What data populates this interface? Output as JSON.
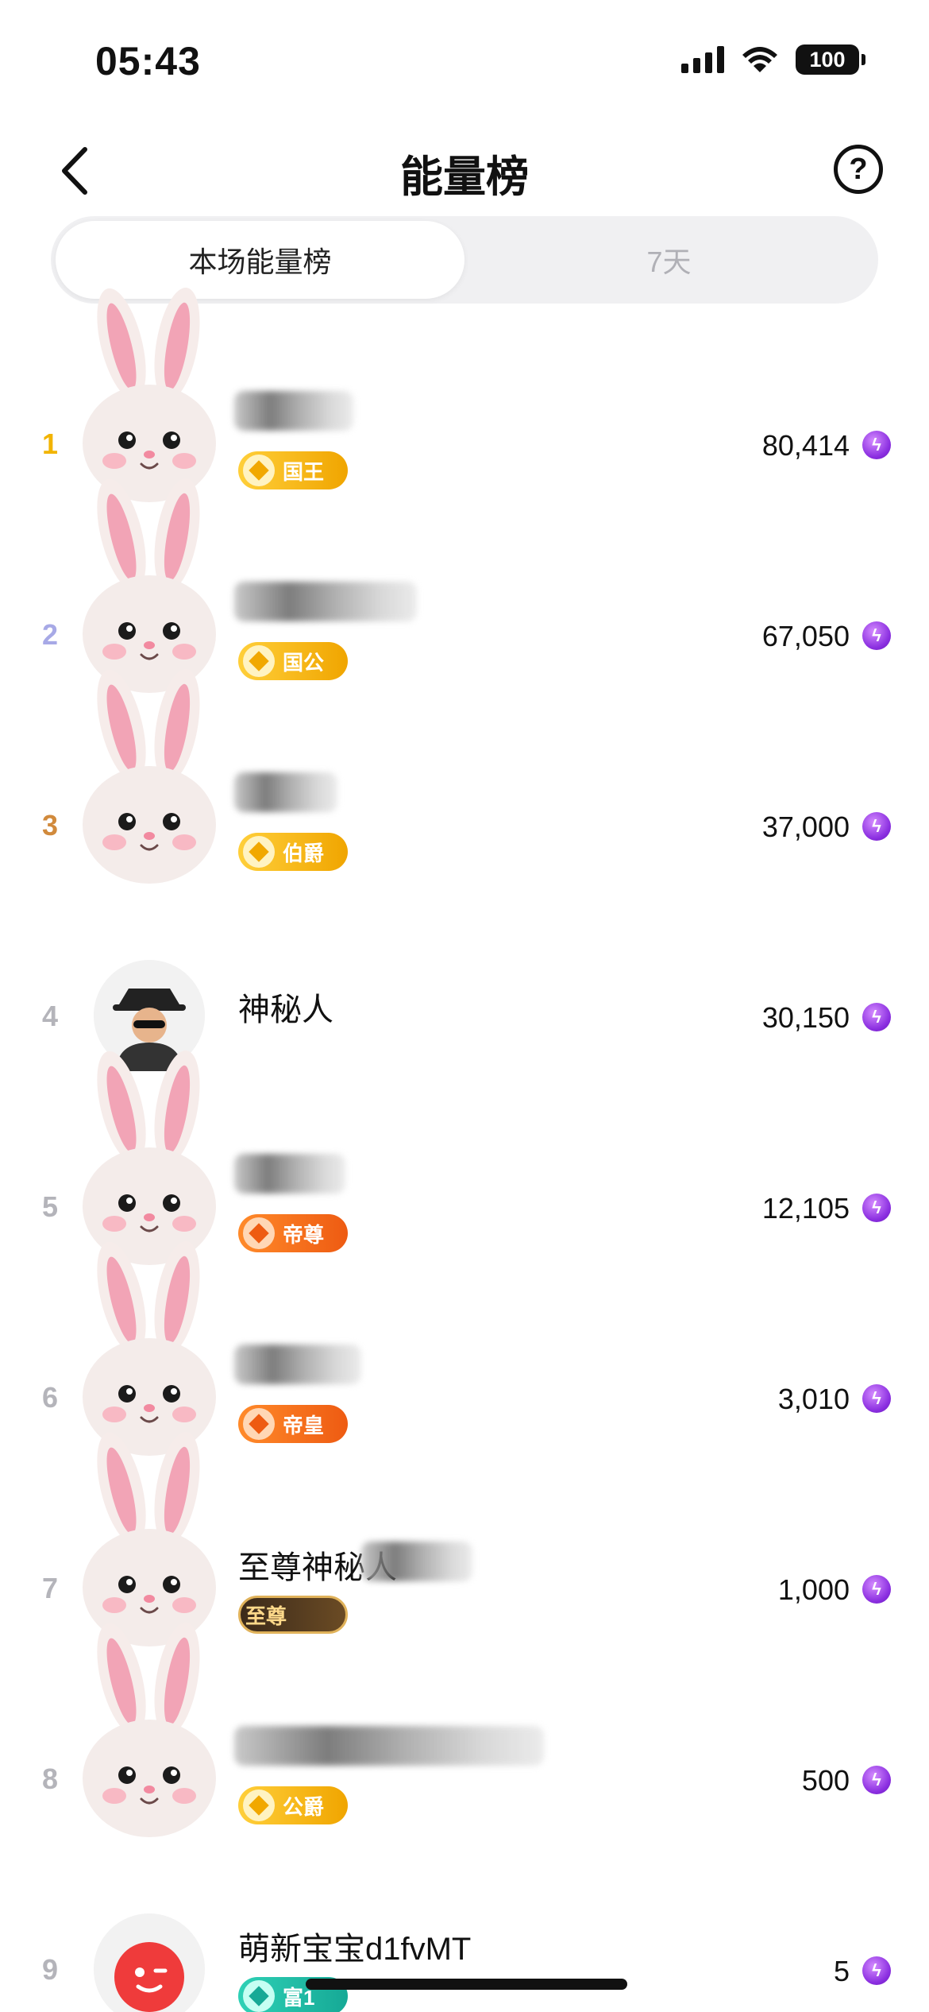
{
  "status_bar": {
    "time": "05:43",
    "battery": "100"
  },
  "nav": {
    "title": "能量榜",
    "help_glyph": "?"
  },
  "tabs": [
    {
      "label": "本场能量榜",
      "active": true
    },
    {
      "label": "7天",
      "active": false
    }
  ],
  "rows": [
    {
      "rank": "1",
      "name": "",
      "badge": "国王",
      "badge_style": "gold",
      "score": "80,414",
      "rank_color": "#f2b400"
    },
    {
      "rank": "2",
      "name": "",
      "badge": "国公",
      "badge_style": "gold",
      "score": "67,050",
      "rank_color": "#a7a9e6"
    },
    {
      "rank": "3",
      "name": "",
      "badge": "伯爵",
      "badge_style": "gold",
      "score": "37,000",
      "rank_color": "#d18a3c"
    },
    {
      "rank": "4",
      "name": "神秘人",
      "badge": "",
      "badge_style": "",
      "score": "30,150",
      "rank_color": "#b4b4ba"
    },
    {
      "rank": "5",
      "name": "",
      "badge": "帝尊",
      "badge_style": "orange",
      "score": "12,105",
      "rank_color": "#b4b4ba"
    },
    {
      "rank": "6",
      "name": "",
      "badge": "帝皇",
      "badge_style": "orange",
      "score": "3,010",
      "rank_color": "#b4b4ba"
    },
    {
      "rank": "7",
      "name": "至尊神秘人",
      "badge": "至尊",
      "badge_style": "dark",
      "score": "1,000",
      "rank_color": "#b4b4ba"
    },
    {
      "rank": "8",
      "name": "",
      "badge": "公爵",
      "badge_style": "gold",
      "score": "500",
      "rank_color": "#b4b4ba"
    },
    {
      "rank": "9",
      "name": "萌新宝宝d1fvMT",
      "badge": "富1",
      "badge_style": "teal",
      "score": "5",
      "rank_color": "#b4b4ba"
    }
  ],
  "icons": {
    "back": "chevron-left-icon",
    "help": "question-circle-icon",
    "energy": "lightning-energy-icon",
    "avatar_overlay": "rabbit-ears-icon"
  },
  "colors": {
    "accent_energy": "#8a2ee0",
    "gold_badge": "#f0a500",
    "orange_badge": "#ee5b12"
  }
}
